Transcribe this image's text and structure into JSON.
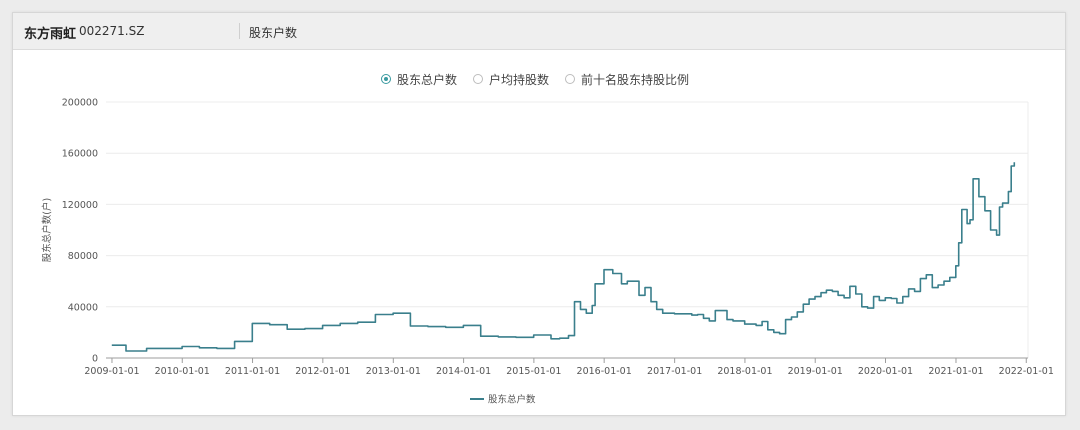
{
  "header": {
    "stock_name": "东方雨虹",
    "stock_code": "002271.SZ",
    "tab_label": "股东户数"
  },
  "radio_options": [
    {
      "label": "股东总户数",
      "selected": true
    },
    {
      "label": "户均持股数",
      "selected": false
    },
    {
      "label": "前十名股东持股比例",
      "selected": false
    }
  ],
  "colors": {
    "series": "#3a7f8c",
    "radio_active": "#3a9aa0"
  },
  "chart_data": {
    "type": "line",
    "title": "",
    "xlabel": "",
    "ylabel": "股东总户数(户)",
    "ylim": [
      0,
      200000
    ],
    "xlim": [
      "2008-12-01",
      "2022-01-10"
    ],
    "yticks": [
      0,
      40000,
      80000,
      120000,
      160000,
      200000
    ],
    "ytick_labels": [
      "0",
      "40000",
      "80000",
      "120000",
      "160000",
      "200000"
    ],
    "xticks": [
      "2009-01-01",
      "2010-01-01",
      "2011-01-01",
      "2012-01-01",
      "2013-01-01",
      "2014-01-01",
      "2015-01-01",
      "2016-01-01",
      "2017-01-01",
      "2018-01-01",
      "2019-01-01",
      "2020-01-01",
      "2021-01-01",
      "2022-01-01"
    ],
    "grid": true,
    "legend_position": "bottom-center",
    "series": [
      {
        "name": "股东总户数",
        "x": [
          "2008-12-31",
          "2009-03-15",
          "2009-06-30",
          "2009-12-31",
          "2010-03-31",
          "2010-06-30",
          "2010-09-30",
          "2010-12-31",
          "2011-03-31",
          "2011-06-30",
          "2011-09-30",
          "2011-12-31",
          "2012-03-31",
          "2012-06-30",
          "2012-09-30",
          "2012-12-31",
          "2013-03-31",
          "2013-06-30",
          "2013-09-30",
          "2013-12-31",
          "2014-03-31",
          "2014-06-30",
          "2014-09-30",
          "2014-12-31",
          "2015-03-31",
          "2015-05-15",
          "2015-06-30",
          "2015-07-31",
          "2015-08-31",
          "2015-09-30",
          "2015-10-31",
          "2015-11-15",
          "2015-12-31",
          "2016-02-15",
          "2016-03-31",
          "2016-04-30",
          "2016-06-30",
          "2016-07-31",
          "2016-08-31",
          "2016-09-30",
          "2016-10-31",
          "2016-12-31",
          "2017-03-31",
          "2017-04-30",
          "2017-05-31",
          "2017-06-30",
          "2017-07-31",
          "2017-09-30",
          "2017-10-31",
          "2017-12-31",
          "2018-02-28",
          "2018-03-31",
          "2018-04-30",
          "2018-05-31",
          "2018-06-30",
          "2018-07-31",
          "2018-08-31",
          "2018-09-30",
          "2018-10-31",
          "2018-11-30",
          "2018-12-31",
          "2019-01-31",
          "2019-02-28",
          "2019-03-31",
          "2019-04-30",
          "2019-05-31",
          "2019-06-30",
          "2019-07-31",
          "2019-08-31",
          "2019-09-30",
          "2019-10-31",
          "2019-11-30",
          "2019-12-31",
          "2020-01-31",
          "2020-02-29",
          "2020-03-31",
          "2020-04-30",
          "2020-05-31",
          "2020-06-30",
          "2020-07-31",
          "2020-08-31",
          "2020-09-30",
          "2020-10-31",
          "2020-11-30",
          "2020-12-31",
          "2021-01-15",
          "2021-01-31",
          "2021-02-28",
          "2021-03-15",
          "2021-03-31",
          "2021-04-30",
          "2021-05-31",
          "2021-06-30",
          "2021-07-31",
          "2021-08-15",
          "2021-08-31",
          "2021-09-30",
          "2021-10-15",
          "2021-10-31"
        ],
        "values": [
          10000,
          5500,
          7500,
          9000,
          8000,
          7500,
          13000,
          27000,
          26000,
          22500,
          23000,
          25500,
          27000,
          28000,
          34000,
          35000,
          25000,
          24500,
          24000,
          25500,
          17000,
          16500,
          16200,
          18000,
          15000,
          15500,
          17500,
          44000,
          38000,
          35000,
          41000,
          58000,
          69000,
          66000,
          58000,
          60000,
          49000,
          55000,
          44000,
          38000,
          35000,
          34500,
          33500,
          34000,
          31000,
          29000,
          37000,
          30000,
          29000,
          26500,
          25500,
          28500,
          22000,
          20000,
          19000,
          30000,
          32000,
          36000,
          42000,
          46000,
          48000,
          51000,
          53000,
          52000,
          49000,
          47000,
          56000,
          50000,
          40000,
          39000,
          48000,
          45000,
          47000,
          46500,
          43000,
          48000,
          54000,
          52000,
          62000,
          65000,
          55000,
          57000,
          60000,
          63000,
          72000,
          90000,
          116000,
          105000,
          108000,
          140000,
          126000,
          115000,
          100000,
          96000,
          118000,
          121000,
          130000,
          150000,
          153000
        ]
      }
    ]
  }
}
